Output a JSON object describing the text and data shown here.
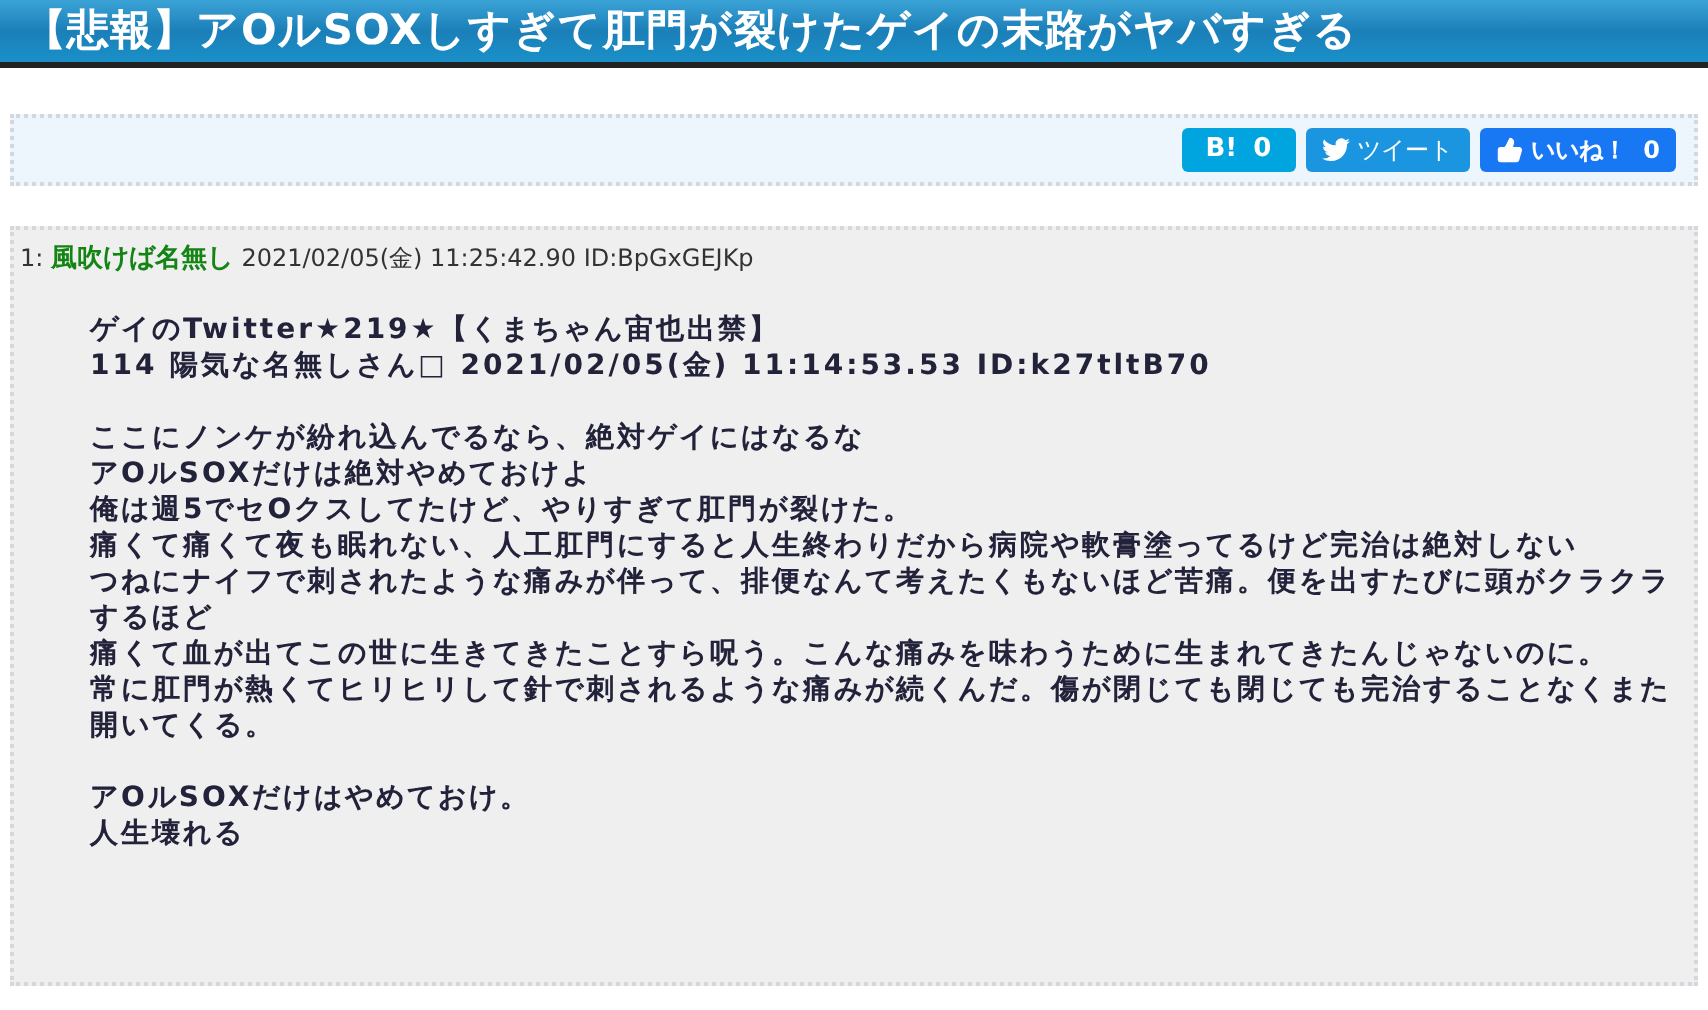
{
  "title": "【悲報】アOルSOXしすぎて肛門が裂けたゲイの末路がヤバすぎる",
  "share_buttons": [
    {
      "kind": "hatena",
      "label": "B!",
      "count": "0"
    },
    {
      "kind": "tweet",
      "label": "ツイート"
    },
    {
      "kind": "like",
      "label": "いいね！",
      "count": "0"
    }
  ],
  "post": {
    "number": "1:",
    "name": "風吹けば名無し",
    "date": "2021/02/05(金) 11:25:42.90 ID:BpGxGEJKp",
    "quote_lines": [
      "ゲイのTwitter★219★【くまちゃん宙也出禁】",
      "114 陽気な名無しさん□ 2021/02/05(金) 11:14:53.53 ID:k27tltB70"
    ],
    "paragraphs": [
      [
        "ここにノンケが紛れ込んでるなら、絶対ゲイにはなるな",
        "アOルSOXだけは絶対やめておけよ",
        "俺は週5でセOクスしてたけど、やりすぎて肛門が裂けた。",
        "痛くて痛くて夜も眠れない、人工肛門にすると人生終わりだから病院や軟膏塗ってるけど完治は絶対しない",
        "つねにナイフで刺されたような痛みが伴って、排便なんて考えたくもないほど苦痛。便を出すたびに頭がクラクラするほど",
        "痛くて血が出てこの世に生きてきたことすら呪う。こんな痛みを味わうために生まれてきたんじゃないのに。",
        "常に肛門が熱くてヒリヒリして針で刺されるような痛みが続くんだ。傷が閉じても閉じても完治することなくまた開いてくる。"
      ],
      [
        "アOルSOXだけはやめておけ。",
        "人生壊れる"
      ]
    ]
  }
}
